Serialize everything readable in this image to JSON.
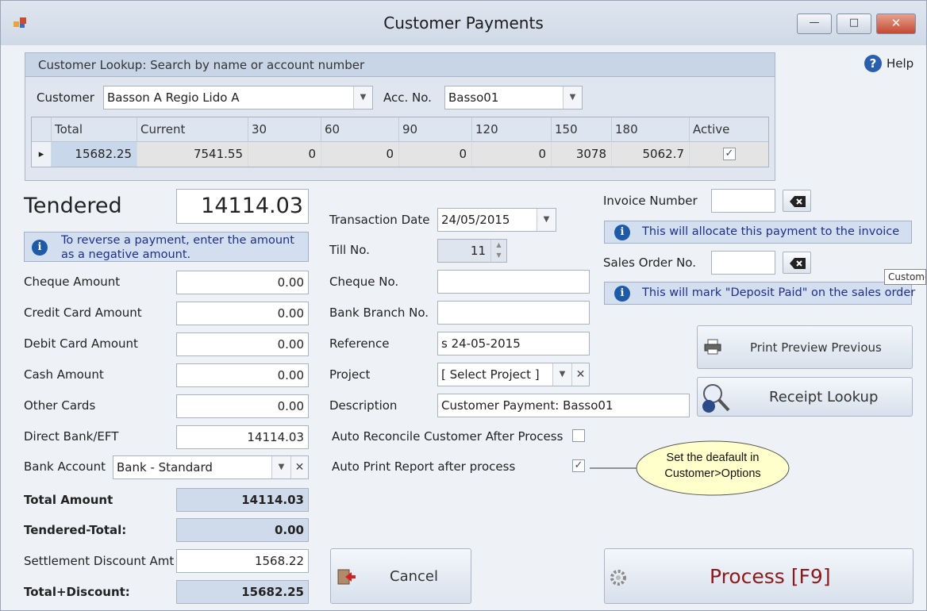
{
  "window": {
    "title": "Customer Payments",
    "minimize_label": "—",
    "restore_label": "□",
    "close_label": "✕"
  },
  "help": {
    "label": "Help",
    "icon": "help-icon"
  },
  "lookup": {
    "header": "Customer Lookup: Search by name or account number",
    "customer_label": "Customer",
    "customer_value": "Basson A Regio Lido A",
    "acc_label": "Acc. No.",
    "acc_value": "Basso01",
    "grid": {
      "columns": [
        "Total",
        "Current",
        "30",
        "60",
        "90",
        "120",
        "150",
        "180",
        "Active"
      ],
      "row": [
        "15682.25",
        "7541.55",
        "0",
        "0",
        "0",
        "0",
        "3078",
        "5062.7"
      ],
      "active_checked": true,
      "row_indicator": "▸"
    }
  },
  "tender": {
    "title": "Tendered",
    "value": "14114.03",
    "info": "To reverse a payment, enter the amount as a negative amount.",
    "fields": [
      {
        "label": "Cheque Amount",
        "value": "0.00"
      },
      {
        "label": "Credit Card Amount",
        "value": "0.00"
      },
      {
        "label": "Debit Card Amount",
        "value": "0.00"
      },
      {
        "label": "Cash Amount",
        "value": "0.00"
      },
      {
        "label": "Other Cards",
        "value": "0.00"
      },
      {
        "label": "Direct Bank/EFT",
        "value": "14114.03"
      }
    ],
    "bank_account_label": "Bank Account",
    "bank_account_value": "Bank - Standard",
    "total_amount_label": "Total Amount",
    "total_amount_value": "14114.03",
    "tendered_total_label": "Tendered-Total:",
    "tendered_total_value": "0.00",
    "settlement_label": "Settlement Discount Amt",
    "settlement_value": "1568.22",
    "total_discount_label": "Total+Discount:",
    "total_discount_value": "15682.25"
  },
  "transaction": {
    "date_label": "Transaction Date",
    "date_value": "24/05/2015",
    "till_label": "Till No.",
    "till_value": "11",
    "cheque_no_label": "Cheque No.",
    "cheque_no_value": "",
    "bank_branch_label": "Bank Branch No.",
    "bank_branch_value": "",
    "reference_label": "Reference",
    "reference_value": "s 24-05-2015",
    "project_label": "Project",
    "project_value": "[ Select Project ]",
    "description_label": "Description",
    "description_value": "Customer Payment: Basso01",
    "auto_reconcile_label": "Auto Reconcile Customer After Process",
    "auto_reconcile_checked": false,
    "auto_print_label": "Auto Print Report after process",
    "auto_print_checked": true,
    "callout": "Set the deafault in Customer>Options"
  },
  "invoice": {
    "label": "Invoice Number",
    "value": "",
    "info": "This will allocate this payment to the invoice"
  },
  "sales_order": {
    "label": "Sales Order No.",
    "value": "",
    "info": "This will mark \"Deposit Paid\" on the sales order",
    "tooltip": "Custome"
  },
  "buttons": {
    "print_preview": "Print Preview Previous",
    "receipt_lookup": "Receipt Lookup",
    "cancel": "Cancel",
    "process": "Process [F9]"
  },
  "colors": {
    "process_text": "#8b1a1a",
    "info_text": "#1d2f8a",
    "readonly_bg": "#cfdaea"
  }
}
